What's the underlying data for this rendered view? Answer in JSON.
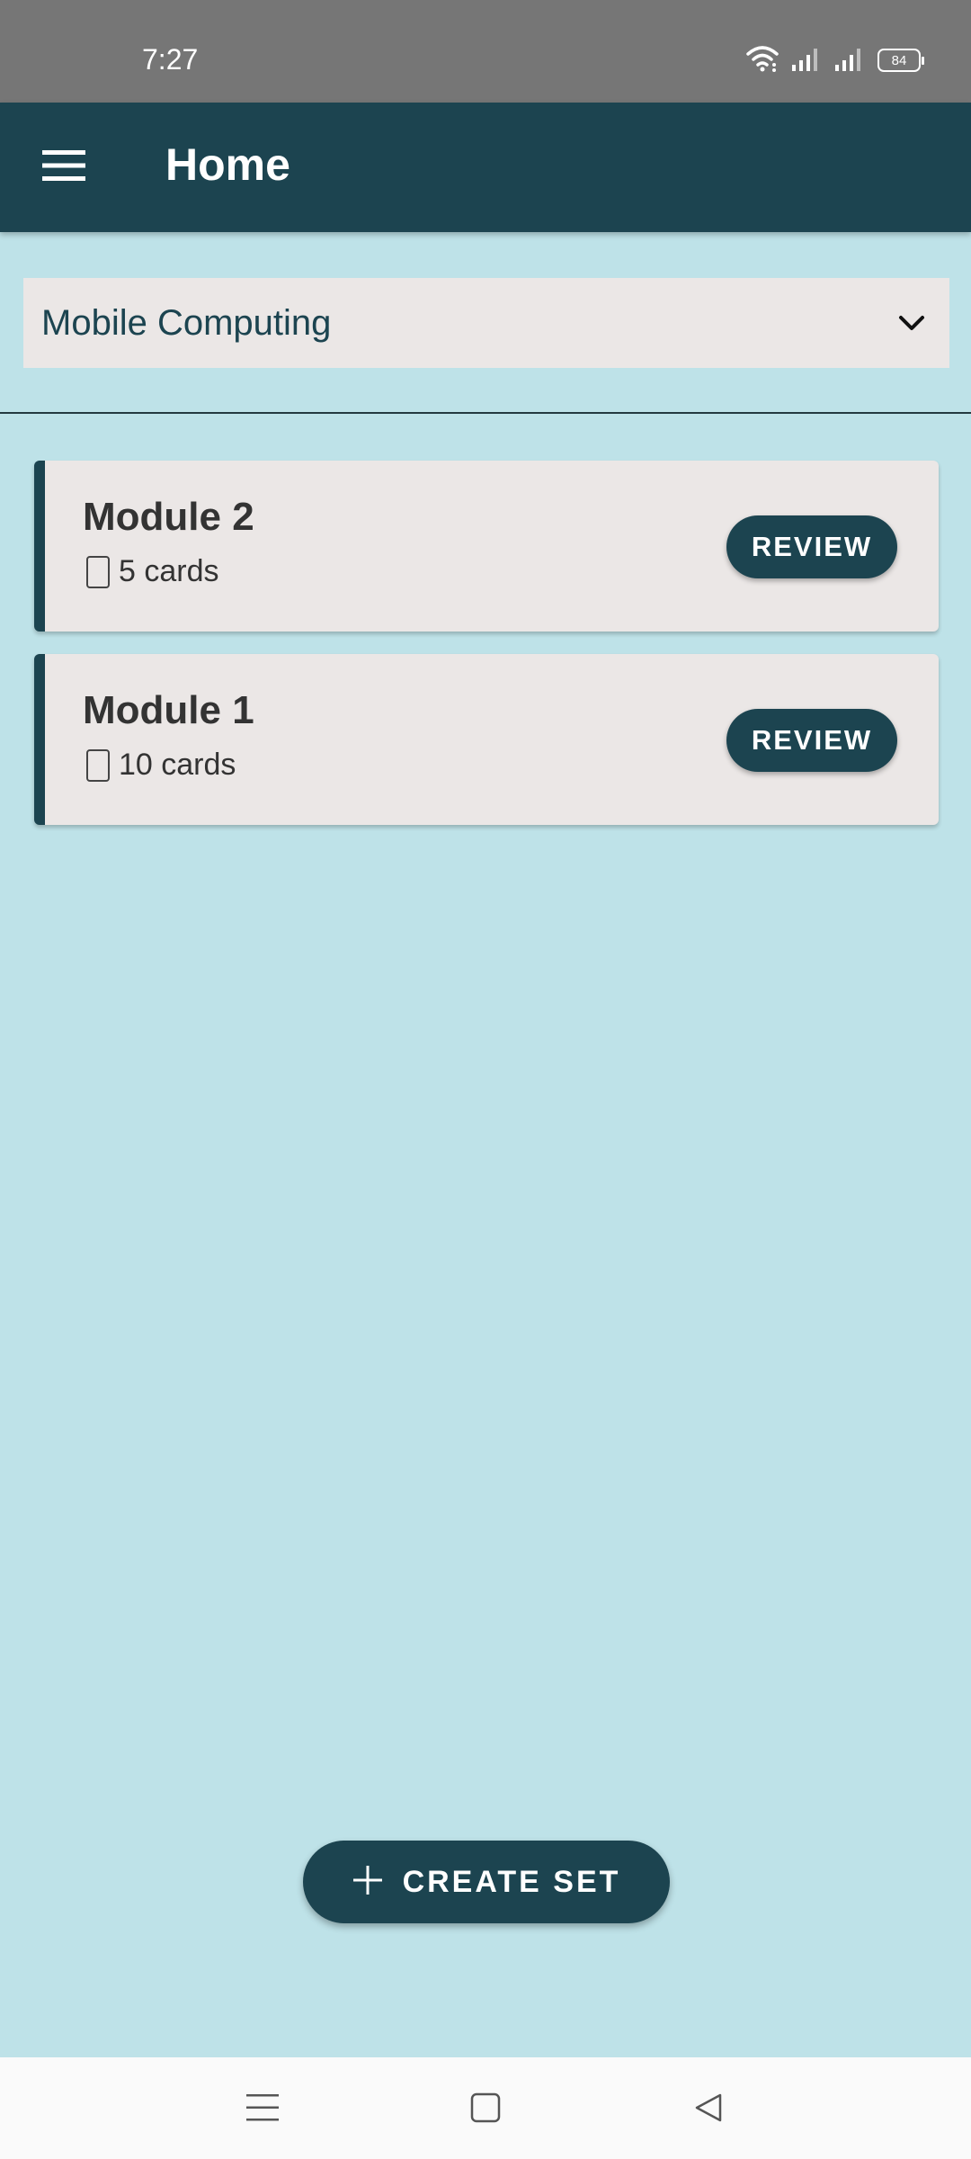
{
  "status_bar": {
    "time": "7:27",
    "battery": "84",
    "icons": [
      "wifi-icon",
      "signal-icon",
      "signal-icon",
      "battery-icon"
    ]
  },
  "app_bar": {
    "title": "Home",
    "menu_icon": "hamburger-menu-icon"
  },
  "course_select": {
    "value": "Mobile Computing",
    "icon": "chevron-down-icon"
  },
  "sets": [
    {
      "title": "Module 2",
      "count": "5 cards",
      "icon": "card-icon",
      "action": "REVIEW"
    },
    {
      "title": "Module 1",
      "count": "10 cards",
      "icon": "card-icon",
      "action": "REVIEW"
    }
  ],
  "fab": {
    "label": "CREATE SET",
    "icon": "plus-icon"
  },
  "nav_bar": {
    "icons": [
      "recent-apps-icon",
      "home-icon",
      "back-icon"
    ]
  },
  "colors": {
    "primary": "#1c4450",
    "background": "#bee2e8",
    "surface": "#ebe7e6",
    "status_bar": "#767676"
  }
}
